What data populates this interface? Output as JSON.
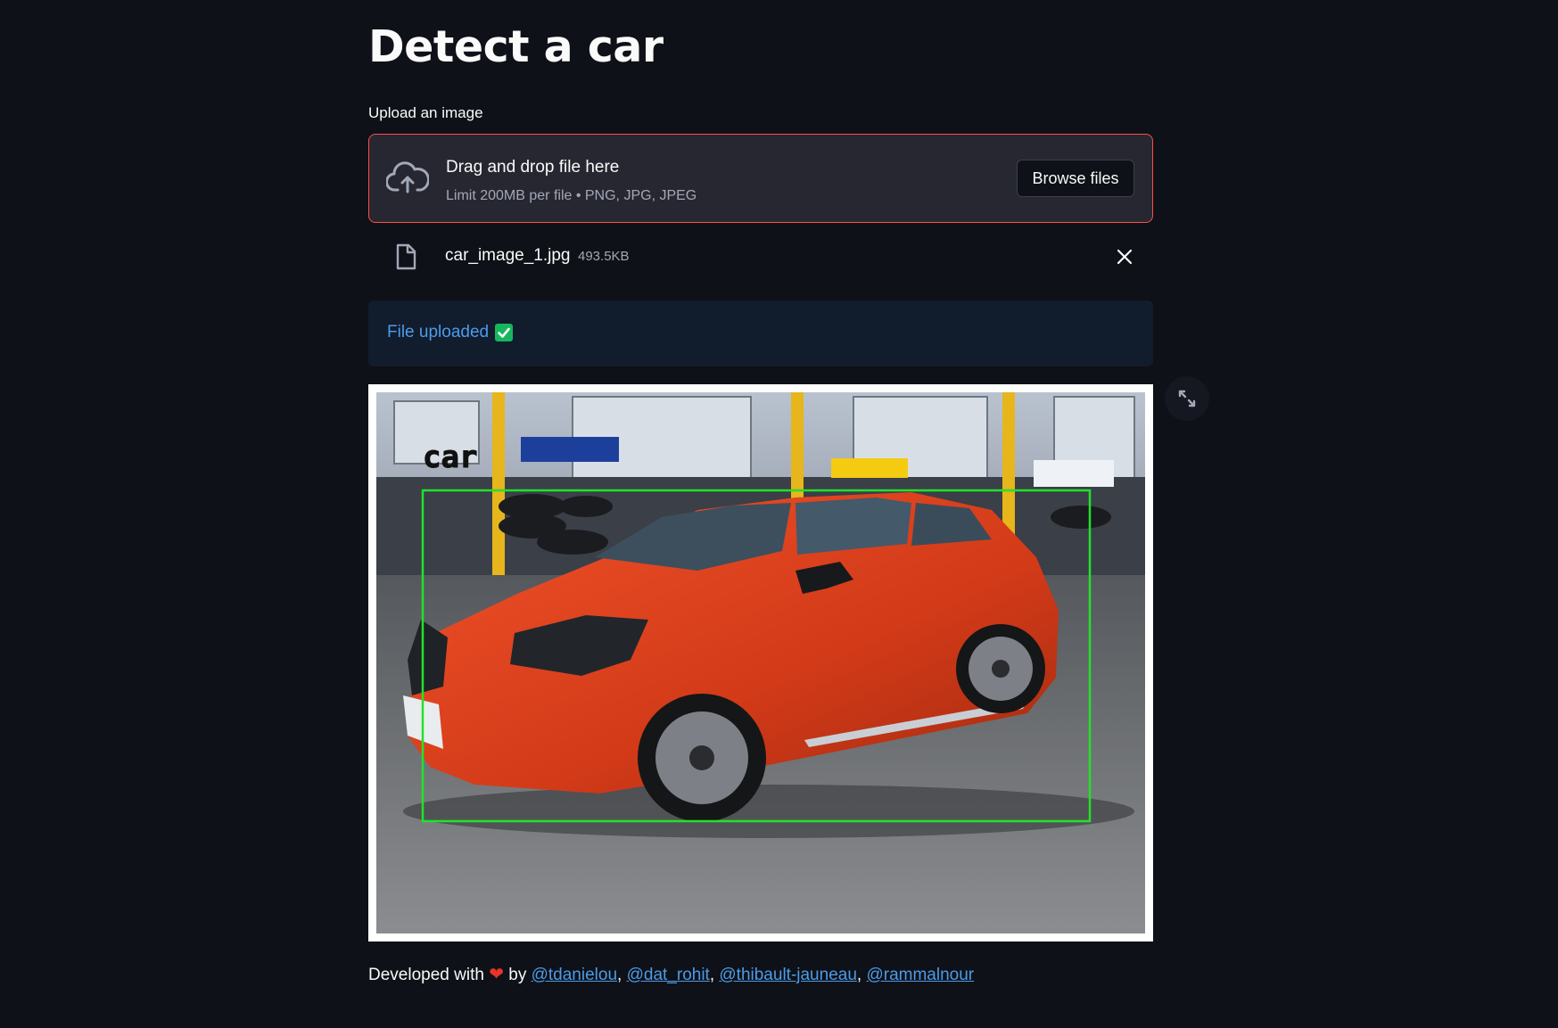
{
  "page": {
    "title": "Detect a car"
  },
  "uploader": {
    "label": "Upload an image",
    "drop_text": "Drag and drop file here",
    "limit_text": "Limit 200MB per file • PNG, JPG, JPEG",
    "browse_label": "Browse files",
    "icon": "cloud-upload-icon"
  },
  "file": {
    "name": "car_image_1.jpg",
    "size": "493.5KB"
  },
  "alert": {
    "text": "File uploaded"
  },
  "result": {
    "detection_label": "car"
  },
  "footer": {
    "prefix": "Developed with",
    "by": "by",
    "authors": [
      "@tdanielou",
      "@dat_rohit",
      "@thibault-jauneau",
      "@rammalnour"
    ],
    "sep": ","
  },
  "colors": {
    "background": "#0e1117",
    "accent_error_border": "#ff4b4b",
    "info_text": "#4d9be8",
    "check": "#17b65d",
    "box": "#22e22a"
  }
}
